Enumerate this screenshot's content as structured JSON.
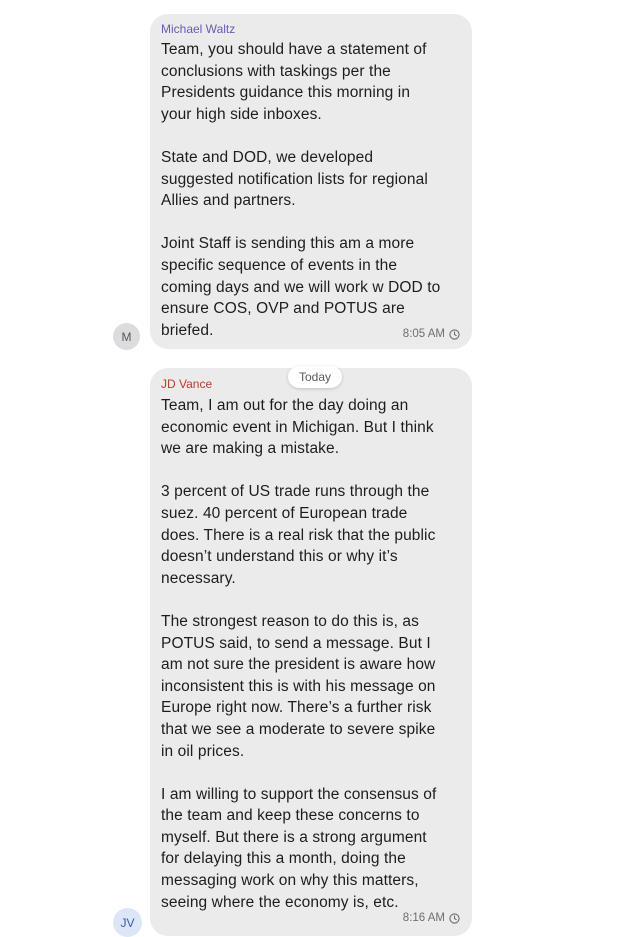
{
  "date_separator": "Today",
  "messages": [
    {
      "sender": "Michael Waltz",
      "avatar_initials": "M",
      "text": "Team, you should have a statement of\nconclusions with taskings per the\nPresidents guidance this morning in\nyour high side inboxes.\n\nState and DOD, we developed\nsuggested notification lists for regional\nAllies and partners.\n\nJoint Staff is sending this am a more\nspecific sequence of events in the\ncoming days and we will work w DOD to\nensure COS, OVP and POTUS are\nbriefed.",
      "time": "8:05 AM",
      "status_icon": "clock-icon"
    },
    {
      "sender": "JD Vance",
      "avatar_initials": "JV",
      "text": "Team, I am out for the day doing an\neconomic event in Michigan. But I think\nwe are making a mistake.\n\n3 percent of US trade runs through the\nsuez. 40 percent of European trade\ndoes. There is a real risk that the public\ndoesn’t understand this or why it’s\nnecessary.\n\nThe strongest reason to do this is, as\nPOTUS said, to send a message.  But I\nam not sure the president is aware how\ninconsistent this is with his message on\nEurope right now. There’s a further risk\nthat we see a moderate to severe spike\nin oil prices.\n\nI am willing to support the consensus of\nthe team and keep these concerns to\nmyself. But there is a strong argument\nfor delaying this a month, doing the\nmessaging work on why this matters,\nseeing where the economy is, etc.",
      "time": "8:16 AM",
      "status_icon": "clock-icon"
    }
  ],
  "colors": {
    "bubble_background": "#ebebeb",
    "sender_michael_waltz": "#6b5ab0",
    "sender_jd_vance": "#c0392b",
    "avatar_m_background": "#dcdcde",
    "avatar_jv_background": "#dde6f6"
  }
}
